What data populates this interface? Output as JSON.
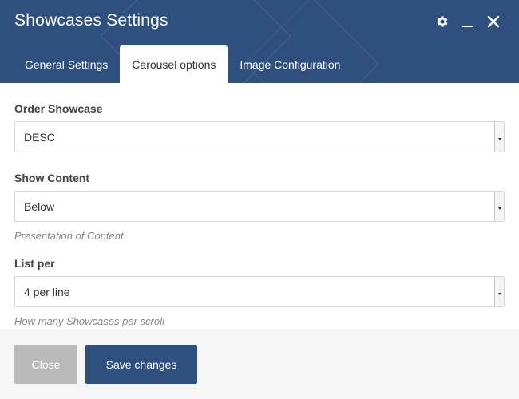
{
  "dialog": {
    "title": "Showcases Settings",
    "colors": {
      "header": "#2f4f7e",
      "close_button": "#b9b9b9",
      "save_button": "#2f4f7e"
    },
    "icons": [
      "gear-icon",
      "minimize-icon",
      "close-icon"
    ]
  },
  "tabs": [
    {
      "label": "General Settings",
      "active": false
    },
    {
      "label": "Carousel options",
      "active": true
    },
    {
      "label": "Image Configuration",
      "active": false
    }
  ],
  "fields": {
    "order": {
      "label": "Order Showcase",
      "value": "DESC"
    },
    "content": {
      "label": "Show Content",
      "value": "Below",
      "help": "Presentation of Content"
    },
    "list_per": {
      "label": "List per",
      "value": "4 per line",
      "help": "How many Showcases per scroll"
    }
  },
  "footer": {
    "close_label": "Close",
    "save_label": "Save changes"
  }
}
